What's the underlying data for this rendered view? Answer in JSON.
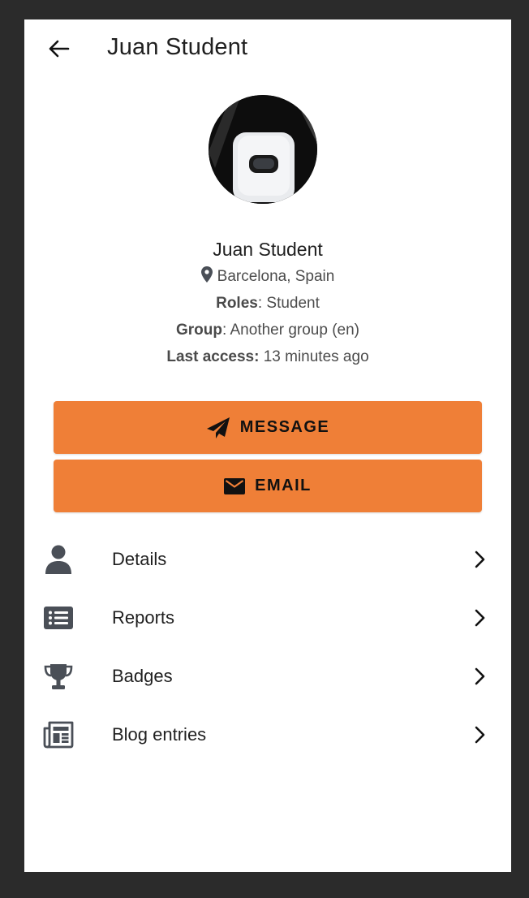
{
  "header": {
    "title": "Juan Student",
    "back_icon": "arrow-left-icon"
  },
  "profile": {
    "name": "Juan Student",
    "location": "Barcelona, Spain",
    "roles_label": "Roles",
    "roles_value": ": Student",
    "group_label": "Group",
    "group_value": ": Another group (en)",
    "last_access_label": "Last access:",
    "last_access_value": " 13 minutes ago"
  },
  "actions": {
    "message_label": "MESSAGE",
    "email_label": "EMAIL"
  },
  "menu": {
    "items": [
      {
        "label": "Details",
        "icon": "user-icon"
      },
      {
        "label": "Reports",
        "icon": "list-icon"
      },
      {
        "label": "Badges",
        "icon": "trophy-icon"
      },
      {
        "label": "Blog entries",
        "icon": "newspaper-icon"
      }
    ]
  },
  "colors": {
    "accent": "#ef7f37",
    "icon": "#4a4f57",
    "background": "#2b2b2b"
  }
}
